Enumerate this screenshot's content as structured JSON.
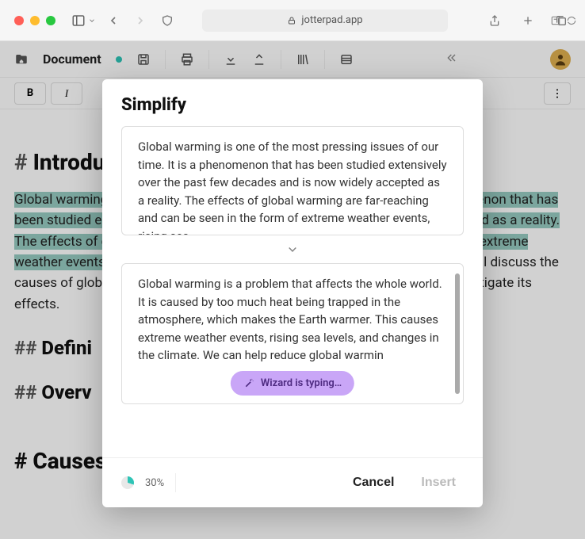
{
  "browser": {
    "url": "jotterpad.app"
  },
  "app": {
    "doc_title": "Document",
    "format": {
      "bold": "B",
      "italic": "I"
    }
  },
  "document": {
    "h1": "# Introduction",
    "para1": "Global warming is one of the most pressing issues of our time. It is a phenomenon that has been studied extensively over the past few decades and is now widely accepted as a reality. The effects of global warming are far-reaching and can be seen in the form of extreme weather events, rising sea levels, and changes in the climate. ",
    "para1_tail": "In this essay, I will discuss the causes of global warming, its effects, and the solutions that can be used to mitigate its effects.",
    "h2a": "## Definition",
    "h2b": "## Overview",
    "h3": "# Causes of Global Warming"
  },
  "modal": {
    "title": "Simplify",
    "source_text": "Global warming is one of the most pressing issues of our time. It is a phenomenon that has been studied extensively over the past few decades and is now widely accepted as a reality. The effects of global warming are far-reaching and can be seen in the form of extreme weather events, rising sea",
    "result_text": "Global warming is a problem that affects the whole world. It is caused by too much heat being trapped in the atmosphere, which makes the Earth warmer. This causes extreme weather events, rising sea levels, and changes in the climate. We can help reduce global warmin",
    "wizard_status": "Wizard is typing…",
    "credits": "30%",
    "cancel": "Cancel",
    "insert": "Insert"
  }
}
